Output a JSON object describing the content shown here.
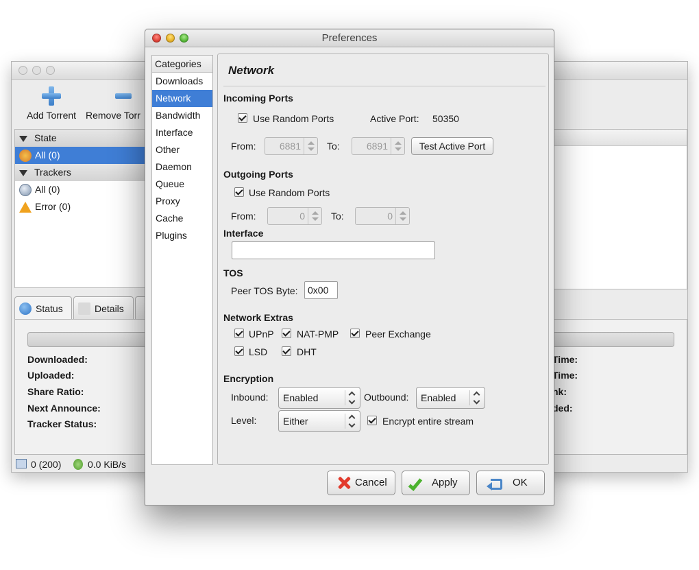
{
  "main_window": {
    "toolbar": {
      "add_torrent": "Add Torrent",
      "remove_torrent": "Remove Torr"
    },
    "sidebar": {
      "state_header": "State",
      "state_all": "All (0)",
      "trackers_header": "Trackers",
      "trackers_all": "All (0)",
      "trackers_error": "Error (0)"
    },
    "tabs": {
      "status": "Status",
      "details": "Details"
    },
    "info_labels": [
      "Downloaded:",
      "Uploaded:",
      "Share Ratio:",
      "Next Announce:",
      "Tracker Status:"
    ],
    "info_labels_right": [
      "Time:",
      "Time:",
      "nk:",
      "ded:"
    ],
    "statusbar": {
      "connections": "0 (200)",
      "down_speed": "0.0 KiB/s"
    }
  },
  "dialog": {
    "title": "Preferences",
    "categories_header": "Categories",
    "categories": [
      "Downloads",
      "Network",
      "Bandwidth",
      "Interface",
      "Other",
      "Daemon",
      "Queue",
      "Proxy",
      "Cache",
      "Plugins"
    ],
    "selected_category": "Network",
    "page_title": "Network",
    "incoming": {
      "section": "Incoming Ports",
      "use_random_label": "Use Random Ports",
      "use_random_checked": true,
      "active_port_label": "Active Port:",
      "active_port_value": "50350",
      "from_label": "From:",
      "from_value": "6881",
      "to_label": "To:",
      "to_value": "6891",
      "test_button": "Test Active Port"
    },
    "outgoing": {
      "section": "Outgoing Ports",
      "use_random_label": "Use Random Ports",
      "use_random_checked": true,
      "from_label": "From:",
      "from_value": "0",
      "to_label": "To:",
      "to_value": "0"
    },
    "interface": {
      "section": "Interface",
      "value": ""
    },
    "tos": {
      "section": "TOS",
      "label": "Peer TOS Byte:",
      "value": "0x00"
    },
    "extras": {
      "section": "Network Extras",
      "upnp": "UPnP",
      "natpmp": "NAT-PMP",
      "peer_exchange": "Peer Exchange",
      "lsd": "LSD",
      "dht": "DHT"
    },
    "encryption": {
      "section": "Encryption",
      "inbound_label": "Inbound:",
      "inbound_value": "Enabled",
      "outbound_label": "Outbound:",
      "outbound_value": "Enabled",
      "level_label": "Level:",
      "level_value": "Either",
      "encrypt_stream_label": "Encrypt entire stream"
    },
    "buttons": {
      "cancel": "Cancel",
      "apply": "Apply",
      "ok": "OK"
    }
  },
  "colors": {
    "selection": "#3f7ed6",
    "cancel_icon": "#e23b2d",
    "apply_icon": "#4cb22e",
    "ok_icon": "#4a86c8"
  }
}
